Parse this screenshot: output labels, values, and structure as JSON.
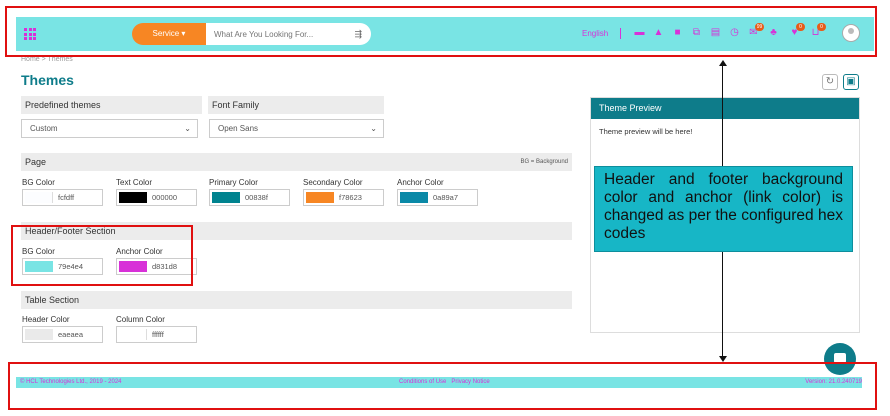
{
  "header": {
    "service_label": "Service ▾",
    "search_placeholder": "What Are You Looking For...",
    "language": "English",
    "icons": [
      {
        "name": "menu-icon",
        "glyph": "▬"
      },
      {
        "name": "warning-icon",
        "glyph": "▲"
      },
      {
        "name": "chat-bubble-icon",
        "glyph": "■"
      },
      {
        "name": "external-link-icon",
        "glyph": "⧉"
      },
      {
        "name": "document-icon",
        "glyph": "▤"
      },
      {
        "name": "history-icon",
        "glyph": "◷"
      },
      {
        "name": "message-icon",
        "glyph": "✉",
        "badge": "99"
      },
      {
        "name": "org-chart-icon",
        "glyph": "♣"
      },
      {
        "name": "thumbs-up-icon",
        "glyph": "♥",
        "badge": "0"
      },
      {
        "name": "cart-icon",
        "glyph": "⊔",
        "badge": "0"
      }
    ]
  },
  "breadcrumb": "Home  >  Themes",
  "title": "Themes",
  "predefined": {
    "label": "Predefined themes",
    "value": "Custom"
  },
  "font": {
    "label": "Font Family",
    "value": "Open Sans"
  },
  "page_section": {
    "title": "Page",
    "note": "BG = Background",
    "fields": [
      {
        "label": "BG Color",
        "hex": "fcfdff",
        "color": "#fcfdff"
      },
      {
        "label": "Text Color",
        "hex": "000000",
        "color": "#000000"
      },
      {
        "label": "Primary Color",
        "hex": "00838f",
        "color": "#00838f"
      },
      {
        "label": "Secondary Color",
        "hex": "f78623",
        "color": "#f78623"
      },
      {
        "label": "Anchor Color",
        "hex": "0a89a7",
        "color": "#0a89a7"
      }
    ]
  },
  "header_footer_section": {
    "title": "Header/Footer Section",
    "fields": [
      {
        "label": "BG Color",
        "hex": "79e4e4",
        "color": "#79e4e4"
      },
      {
        "label": "Anchor Color",
        "hex": "d831d8",
        "color": "#d831d8"
      }
    ]
  },
  "table_section": {
    "title": "Table Section",
    "fields": [
      {
        "label": "Header Color",
        "hex": "eaeaea",
        "color": "#eaeaea"
      },
      {
        "label": "Column Color",
        "hex": "ffffff",
        "color": "#ffffff"
      }
    ]
  },
  "preview": {
    "title": "Theme Preview",
    "body": "Theme preview will be here!"
  },
  "callout": "Header and footer background color and anchor (link color) is changed as per the configured hex codes",
  "footer": {
    "copyright": "© HCL Technologies Ltd., 2019 - 2024",
    "conditions": "Conditions of Use",
    "privacy": "Privacy Notice",
    "version": "Version: 21.0.240719"
  }
}
